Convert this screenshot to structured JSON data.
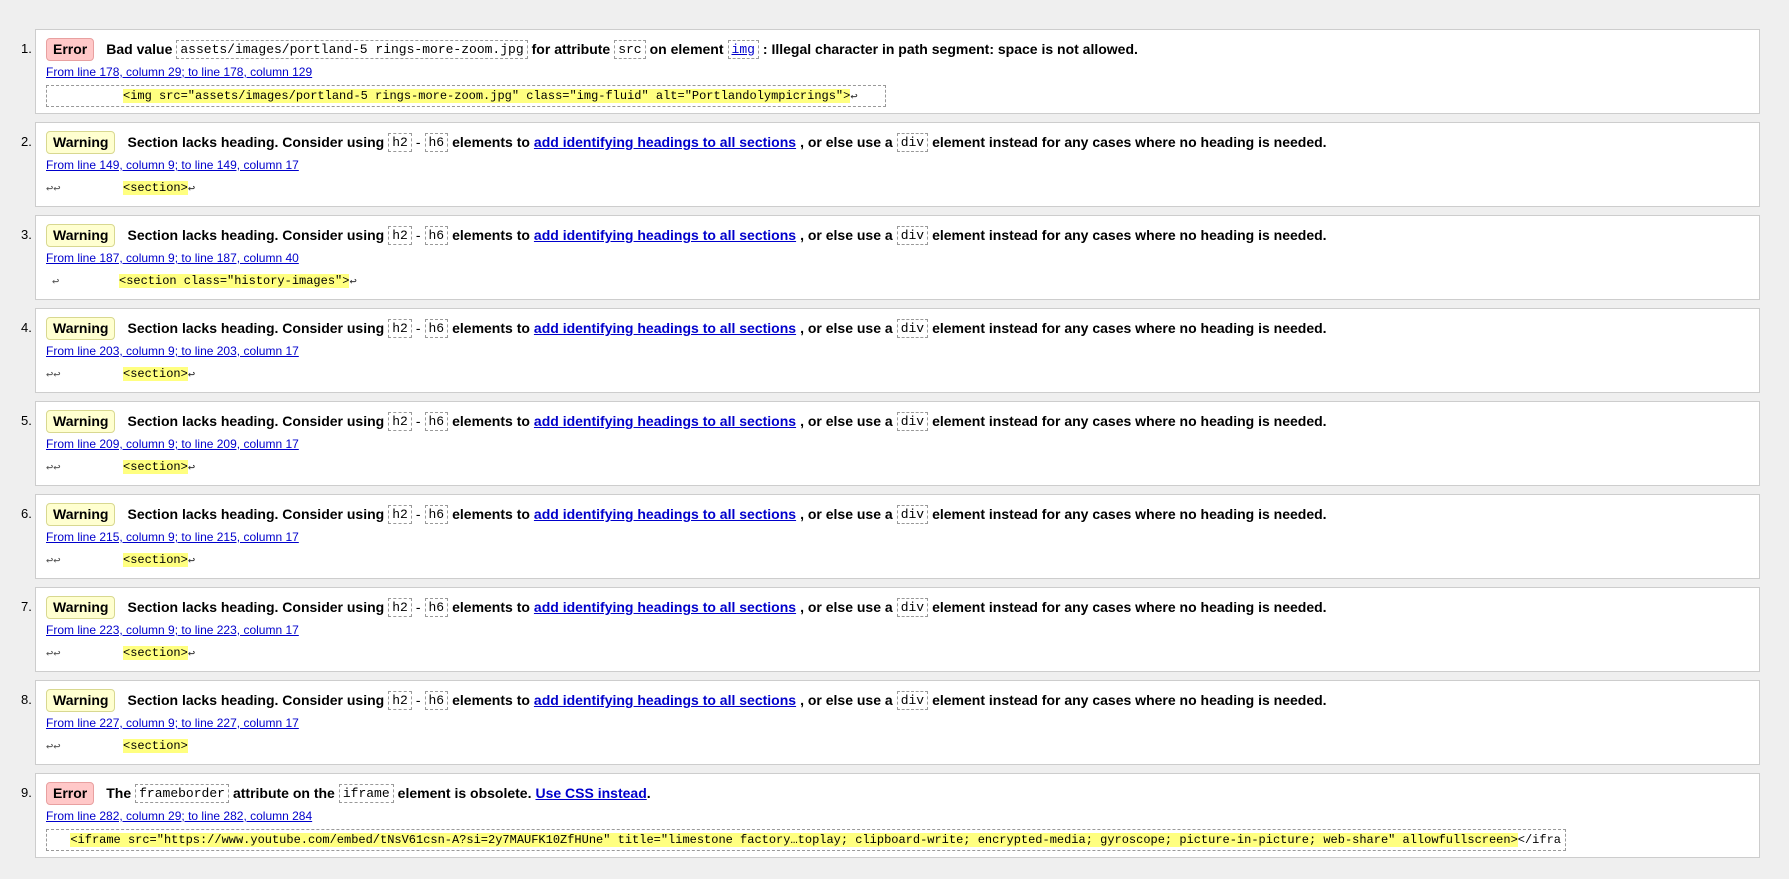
{
  "items": [
    {
      "num": "1.",
      "type": "Error",
      "row": [
        "Bad value",
        "assets/images/portland-5 rings-more-zoom.jpg",
        "for attribute",
        "src",
        "on element",
        "img",
        ": Illegal character in path segment: space is not allowed."
      ],
      "location": "From line 178, column 29; to line 178, column 129",
      "extract_lead": "",
      "extract_code": "<img src=\"assets/images/portland-5 rings-more-zoom.jpg\" class=\"img-fluid\" alt=\"Portlandolympicrings\">",
      "extract_tail": "↩"
    },
    {
      "num": "2.",
      "type": "Warning",
      "msg_start": "Section lacks heading. Consider using",
      "code_h2": "h2",
      "dash": "-",
      "code_h6": "h6",
      "msg_mid": "elements to",
      "link_text": "add identifying headings to all sections",
      "msg_after_link": ", or else use a",
      "code_div": "div",
      "msg_end": "element instead for any cases where no heading is needed.",
      "location": "From line 149, column 9; to line 149, column 17",
      "extract_lead": "↩↩",
      "extract_code": "<section>",
      "extract_tail": "↩"
    },
    {
      "num": "3.",
      "type": "Warning",
      "msg_start": "Section lacks heading. Consider using",
      "code_h2": "h2",
      "dash": "-",
      "code_h6": "h6",
      "msg_mid": "elements to",
      "link_text": "add identifying headings to all sections",
      "msg_after_link": ", or else use a",
      "code_div": "div",
      "msg_end": "element instead for any cases where no heading is needed.",
      "location": "From line 187, column 9; to line 187, column 40",
      "extract_lead": "↩",
      "extract_code": "<section class=\"history-images\">",
      "extract_tail": "↩"
    },
    {
      "num": "4.",
      "type": "Warning",
      "msg_start": "Section lacks heading. Consider using",
      "code_h2": "h2",
      "dash": "-",
      "code_h6": "h6",
      "msg_mid": "elements to",
      "link_text": "add identifying headings to all sections",
      "msg_after_link": ", or else use a",
      "code_div": "div",
      "msg_end": "element instead for any cases where no heading is needed.",
      "location": "From line 203, column 9; to line 203, column 17",
      "extract_lead": "↩↩",
      "extract_code": "<section>",
      "extract_tail": "↩"
    },
    {
      "num": "5.",
      "type": "Warning",
      "msg_start": "Section lacks heading. Consider using",
      "code_h2": "h2",
      "dash": "-",
      "code_h6": "h6",
      "msg_mid": "elements to",
      "link_text": "add identifying headings to all sections",
      "msg_after_link": ", or else use a",
      "code_div": "div",
      "msg_end": "element instead for any cases where no heading is needed.",
      "location": "From line 209, column 9; to line 209, column 17",
      "extract_lead": "↩↩",
      "extract_code": "<section>",
      "extract_tail": "↩"
    },
    {
      "num": "6.",
      "type": "Warning",
      "msg_start": "Section lacks heading. Consider using",
      "code_h2": "h2",
      "dash": "-",
      "code_h6": "h6",
      "msg_mid": "elements to",
      "link_text": "add identifying headings to all sections",
      "msg_after_link": ", or else use a",
      "code_div": "div",
      "msg_end": "element instead for any cases where no heading is needed.",
      "location": "From line 215, column 9; to line 215, column 17",
      "extract_lead": "↩↩",
      "extract_code": "<section>",
      "extract_tail": "↩"
    },
    {
      "num": "7.",
      "type": "Warning",
      "msg_start": "Section lacks heading. Consider using",
      "code_h2": "h2",
      "dash": "-",
      "code_h6": "h6",
      "msg_mid": "elements to",
      "link_text": "add identifying headings to all sections",
      "msg_after_link": ", or else use a",
      "code_div": "div",
      "msg_end": "element instead for any cases where no heading is needed.",
      "location": "From line 223, column 9; to line 223, column 17",
      "extract_lead": "↩↩",
      "extract_code": "<section>",
      "extract_tail": "↩"
    },
    {
      "num": "8.",
      "type": "Warning",
      "msg_start": "Section lacks heading. Consider using",
      "code_h2": "h2",
      "dash": "-",
      "code_h6": "h6",
      "msg_mid": "elements to",
      "link_text": "add identifying headings to all sections",
      "msg_after_link": ", or else use a",
      "code_div": "div",
      "msg_end": "element instead for any cases where no heading is needed.",
      "location": "From line 227, column 9; to line 227, column 17",
      "extract_lead": "↩↩",
      "extract_code": "<section>",
      "extract_tail": ""
    },
    {
      "num": "9.",
      "type": "Error",
      "msg_start": "The",
      "code_attr": "frameborder",
      "msg_mid": "attribute on the",
      "code_el": "iframe",
      "msg_after": "element is obsolete.",
      "link_text": "Use CSS instead",
      "msg_end": ".",
      "location": "From line 282, column 29; to line 282, column 284",
      "extract_lead": "",
      "extract_code": "<iframe src=\"https://www.youtube.com/embed/tNsV61csn-A?si=2y7MAUFK10ZfHUne\" title=\"limestone factory…toplay; clipboard-write; encrypted-media; gyroscope; picture-in-picture; web-share\" allowfullscreen>",
      "extract_tail": "</ifra"
    }
  ]
}
